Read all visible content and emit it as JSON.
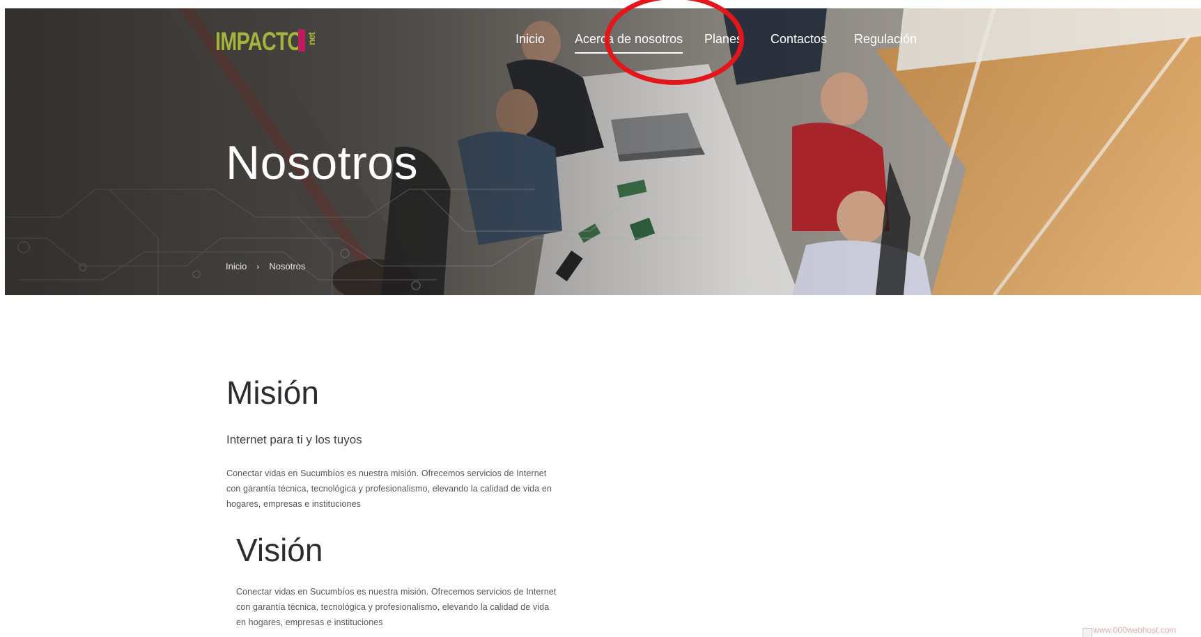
{
  "logo": {
    "main": "IMPACTO",
    "bang": "!",
    "suffix": "net"
  },
  "nav": {
    "items": [
      {
        "label": "Inicio"
      },
      {
        "label": "Acerca de nosotros",
        "active": true
      },
      {
        "label": "Planes"
      },
      {
        "label": "Contactos"
      },
      {
        "label": "Regulación"
      }
    ]
  },
  "hero": {
    "title": "Nosotros",
    "breadcrumb": {
      "home": "Inicio",
      "separator": "›",
      "current": "Nosotros"
    }
  },
  "mission": {
    "title": "Misión",
    "subtitle": "Internet para ti y los tuyos",
    "lines": [
      "Conectar vidas en Sucumbíos es nuestra misión. Ofrecemos servicios de Internet",
      "con garantía técnica, tecnológica y profesionalismo, elevando la calidad de vida en",
      "hogares, empresas e instituciones"
    ]
  },
  "vision": {
    "title": "Visión",
    "lines": [
      "Conectar vidas en Sucumbíos es nuestra misión. Ofrecemos servicios de Internet",
      "con garantía técnica, tecnológica y profesionalismo, elevando la calidad de vida",
      "en hogares, empresas e instituciones"
    ]
  },
  "footer_badge": {
    "alt_text": "www.000webhost.com"
  },
  "colors": {
    "logo_green": "#a4b33b",
    "logo_magenta": "#c21a5f",
    "annotation_red": "#e3161b",
    "heading": "#2d2b30",
    "body_text": "#55555c"
  }
}
